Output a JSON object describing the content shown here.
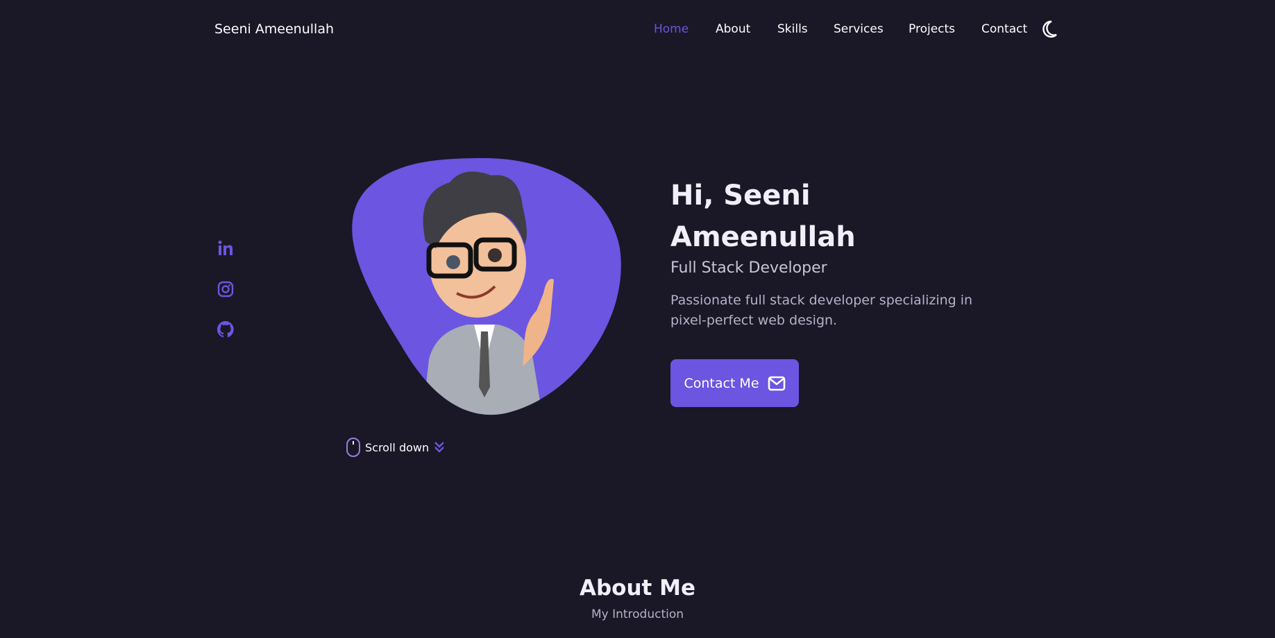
{
  "header": {
    "logo": "Seeni Ameenullah",
    "nav": [
      "Home",
      "About",
      "Skills",
      "Services",
      "Projects",
      "Contact"
    ],
    "active": "Home",
    "theme_icon": "moon-icon"
  },
  "social": {
    "icons": [
      "linkedin-icon",
      "instagram-icon",
      "github-icon"
    ]
  },
  "hero": {
    "greeting_line1": "Hi, Seeni",
    "greeting_line2": "Ameenullah",
    "subtitle": "Full Stack Developer",
    "description": "Passionate full stack developer specializing in pixel-perfect web design.",
    "button": "Contact Me",
    "scroll": "Scroll down"
  },
  "about": {
    "title": "About Me",
    "subtitle": "My Introduction"
  },
  "colors": {
    "accent": "#6c55e0",
    "background": "#1a1727"
  }
}
